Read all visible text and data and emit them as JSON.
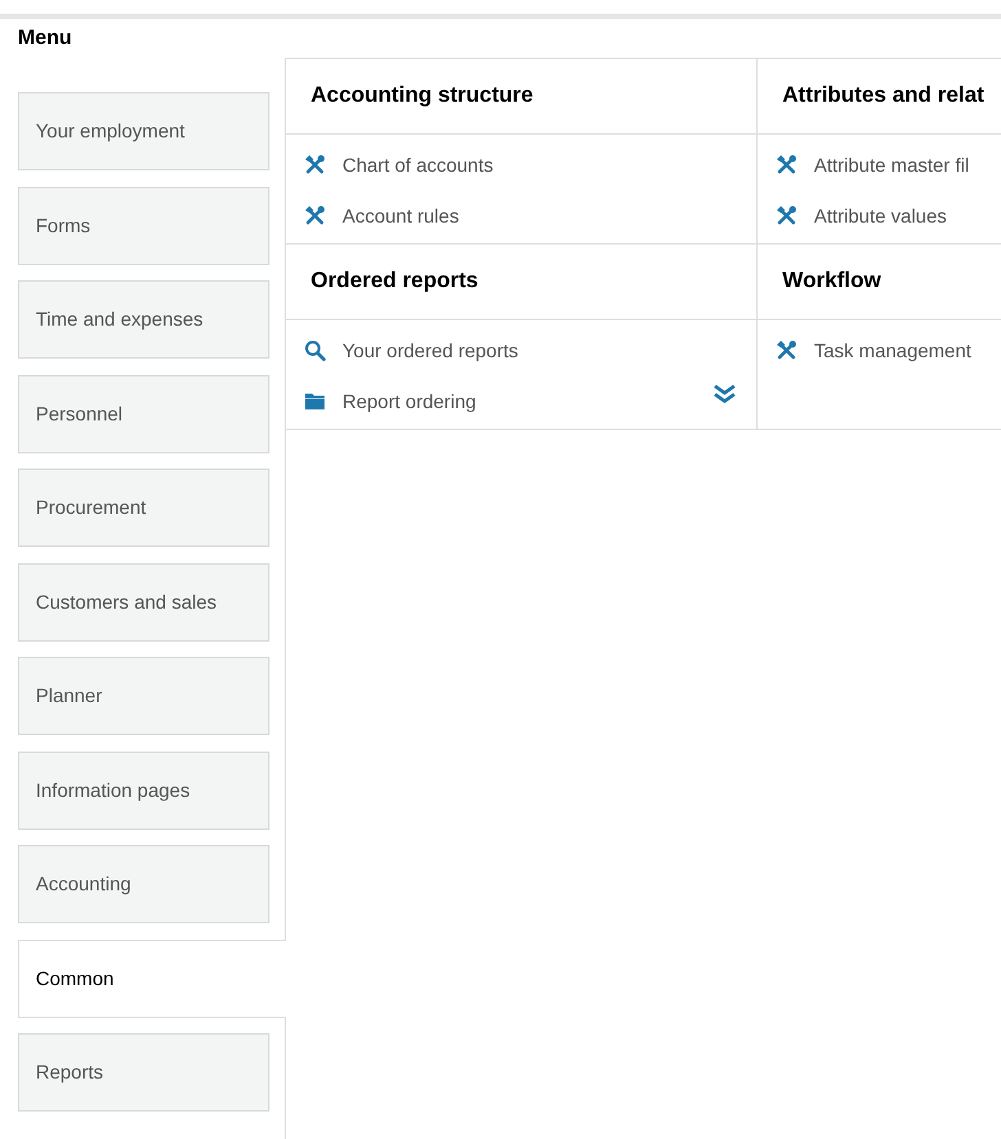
{
  "title": "Menu",
  "sidebar": {
    "items": [
      {
        "label": "Your employment",
        "selected": false
      },
      {
        "label": "Forms",
        "selected": false
      },
      {
        "label": "Time and expenses",
        "selected": false
      },
      {
        "label": "Personnel",
        "selected": false
      },
      {
        "label": "Procurement",
        "selected": false
      },
      {
        "label": "Customers and sales",
        "selected": false
      },
      {
        "label": "Planner",
        "selected": false
      },
      {
        "label": "Information pages",
        "selected": false
      },
      {
        "label": "Accounting",
        "selected": false
      },
      {
        "label": "Common",
        "selected": true
      },
      {
        "label": "Reports",
        "selected": false
      }
    ]
  },
  "sections": [
    {
      "title": "Accounting structure",
      "has_more": false,
      "items": [
        {
          "kind": "tools",
          "label": "Chart of accounts"
        },
        {
          "kind": "tools",
          "label": "Account rules"
        }
      ]
    },
    {
      "title": "Attributes and relat",
      "has_more": false,
      "items": [
        {
          "kind": "tools",
          "label": "Attribute master fil"
        },
        {
          "kind": "tools",
          "label": "Attribute values"
        }
      ]
    },
    {
      "title": "Ordered reports",
      "has_more": true,
      "items": [
        {
          "kind": "search",
          "label": "Your ordered reports"
        },
        {
          "kind": "folder",
          "label": "Report ordering"
        }
      ]
    },
    {
      "title": "Workflow",
      "has_more": false,
      "items": [
        {
          "kind": "tools",
          "label": "Task management"
        }
      ]
    }
  ]
}
